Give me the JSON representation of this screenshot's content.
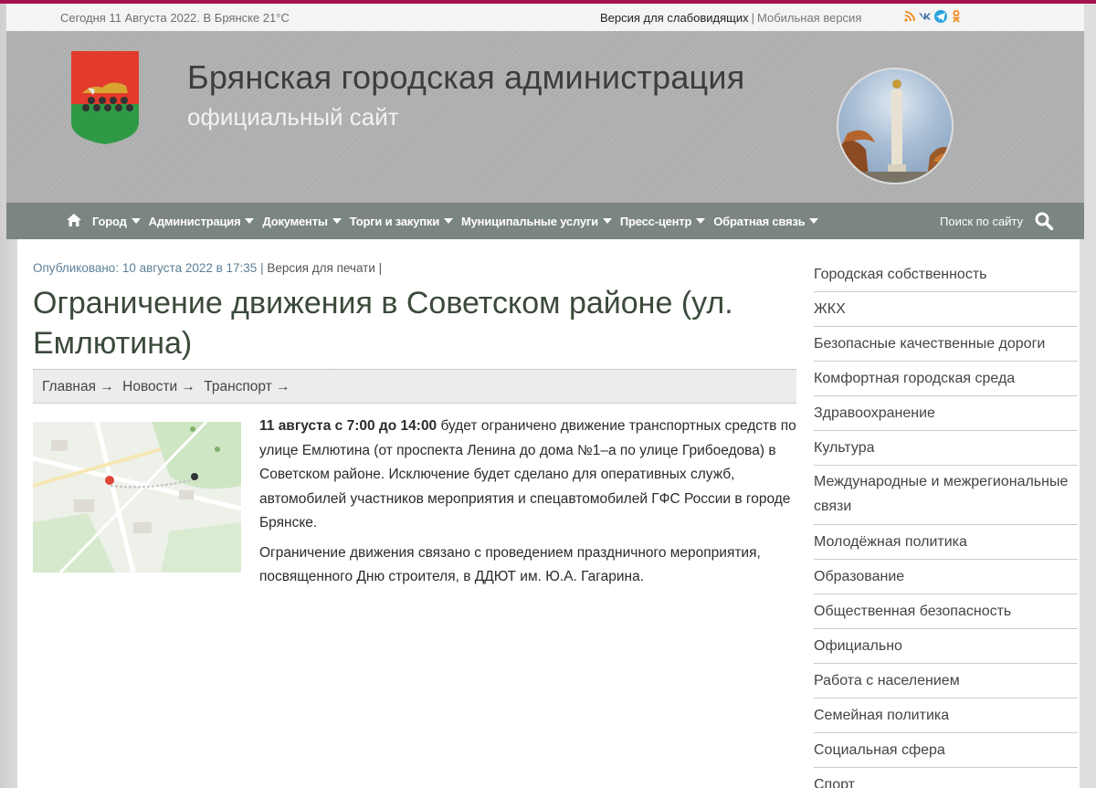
{
  "topbar": {
    "date_weather": "Сегодня 11 Августа 2022. В Брянске 21°C",
    "low_vision_link": "Версия для слабовидящих",
    "separator": "|",
    "mobile_link": "Мобильная версия",
    "social_icons": [
      "rss-icon",
      "vk-icon",
      "telegram-icon",
      "odnoklassniki-icon"
    ]
  },
  "header": {
    "title": "Брянская городская администрация",
    "subtitle": "официальный сайт"
  },
  "nav": {
    "items": [
      {
        "label": "Город"
      },
      {
        "label": "Администрация"
      },
      {
        "label": "Документы"
      },
      {
        "label": "Торги и закупки"
      },
      {
        "label": "Муниципальные услуги"
      },
      {
        "label": "Пресс-центр"
      },
      {
        "label": "Обратная связь"
      }
    ],
    "search_label": "Поиск по сайту"
  },
  "article": {
    "meta_published": "Опубликовано: 10 августа 2022 в 17:35",
    "meta_sep": "|",
    "meta_print": "Версия для печати",
    "meta_sep2": "|",
    "title": "Ограничение движения в Советском районе (ул. Емлютина)",
    "breadcrumbs": [
      "Главная →",
      "Новости →",
      "Транспорт →"
    ],
    "p1_bold": "11 августа с 7:00 до 14:00",
    "p1_rest": " будет ограничено движение транспортных средств по улице Емлютина (от проспекта Ленина до дома №1–а по улице Грибоедова) в Советском районе. Исключение будет сделано для оперативных служб, автомобилей участников мероприятия и спецавтомобилей ГФС России в городе Брянске.",
    "p2": "Ограничение движения связано с проведением праздничного мероприятия, посвященного Дню строителя, в ДДЮТ им. Ю.А. Гагарина."
  },
  "sidebar": {
    "items": [
      "Городская собственность",
      "ЖКХ",
      "Безопасные качественные дороги",
      "Комфортная городская среда",
      "Здравоохранение",
      "Культура",
      "Международные и межрегиональные связи",
      "Молодёжная политика",
      "Образование",
      "Общественная безопасность",
      "Официально",
      "Работа с населением",
      "Семейная политика",
      "Социальная сфера",
      "Спорт"
    ]
  },
  "colors": {
    "accent": "#a6104c",
    "nav_bg": "#7b8581",
    "link_meta": "#5c7f97"
  }
}
